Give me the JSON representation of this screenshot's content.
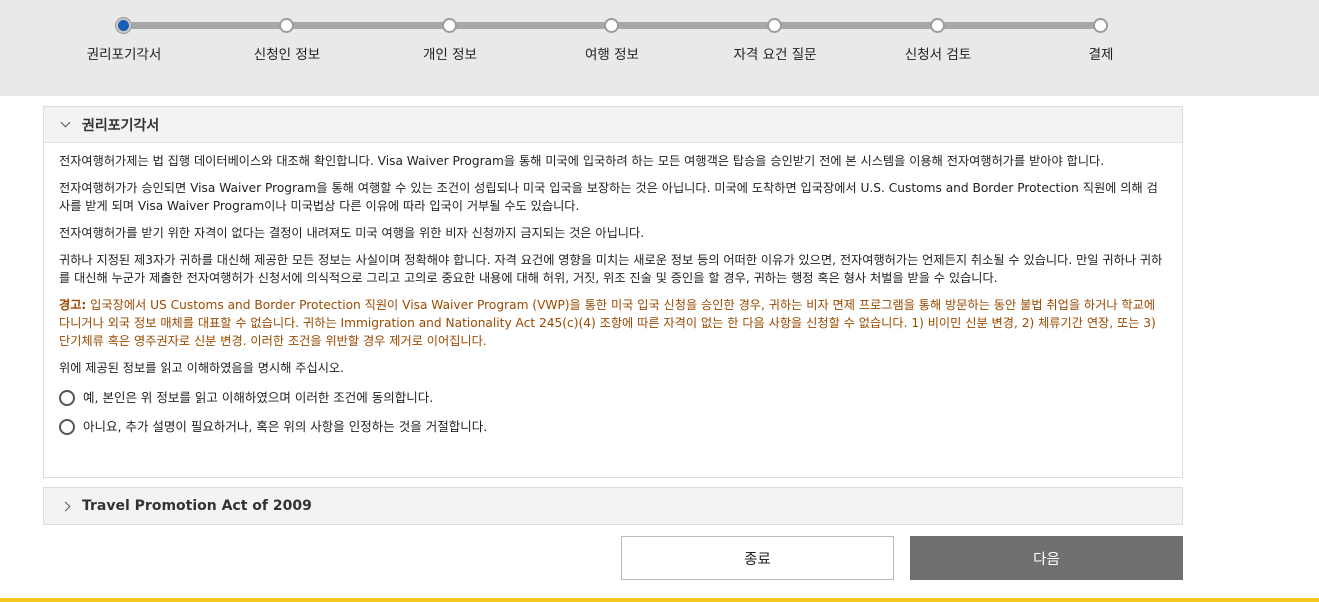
{
  "stepper": {
    "steps": [
      {
        "label": "권리포기각서",
        "active": true
      },
      {
        "label": "신청인 정보",
        "active": false
      },
      {
        "label": "개인 정보",
        "active": false
      },
      {
        "label": "여행 정보",
        "active": false
      },
      {
        "label": "자격 요건 질문",
        "active": false
      },
      {
        "label": "신청서 검토",
        "active": false
      },
      {
        "label": "결제",
        "active": false
      }
    ]
  },
  "waiver": {
    "title": "권리포기각서",
    "p1": "전자여행허가제는 법 집행 데이터베이스와 대조해 확인합니다. Visa Waiver Program을 통해 미국에 입국하려 하는 모든 여행객은 탑승을 승인받기 전에 본 시스템을 이용해 전자여행허가를 받아야 합니다.",
    "p2": "전자여행허가가 승인되면 Visa Waiver Program을 통해 여행할 수 있는 조건이 성립되나 미국 입국을 보장하는 것은 아닙니다. 미국에 도착하면 입국장에서 U.S. Customs and Border Protection 직원에 의해 검사를 받게 되며 Visa Waiver Program이나 미국법상 다른 이유에 따라 입국이 거부될 수도 있습니다.",
    "p3": "전자여행허가를 받기 위한 자격이 없다는 결정이 내려져도 미국 여행을 위한 비자 신청까지 금지되는 것은 아닙니다.",
    "p4": "귀하나 지정된 제3자가 귀하를 대신해 제공한 모든 정보는 사실이며 정확해야 합니다. 자격 요건에 영향을 미치는 새로운 정보 등의 어떠한 이유가 있으면, 전자여행허가는 언제든지 취소될 수 있습니다. 만일 귀하나 귀하를 대신해 누군가 제출한 전자여행허가 신청서에 의식적으로 그리고 고의로 중요한 내용에 대해 허위, 거짓, 위조 진술 및 증인을 할 경우, 귀하는 행정 혹은 형사 처벌을 받을 수 있습니다.",
    "warning_label": "경고:",
    "warning_text": " 입국장에서 US Customs and Border Protection 직원이 Visa Waiver Program (VWP)을 통한 미국 입국 신청을 승인한 경우, 귀하는 비자 면제 프로그램을 통해 방문하는 동안 불법 취업을 하거나 학교에 다니거나 외국 정보 매체를 대표할 수 없습니다. 귀하는 Immigration and Nationality Act 245(c)(4) 조항에 따른 자격이 없는 한 다음 사항을 신청할 수 없습니다. 1) 비이민 신분 변경, 2) 체류기간 연장, 또는 3) 단기체류 혹은 영주권자로 신분 변경. 이러한 조건을 위반할 경우 제거로 이어집니다.",
    "confirm_prompt": "위에 제공된 정보를 읽고 이해하였음을 명시해 주십시오.",
    "option_yes": "예, 본인은 위 정보를 읽고 이해하였으며 이러한 조건에 동의합니다.",
    "option_no": "아니요, 추가 설명이 필요하거나, 혹은 위의 사항을 인정하는 것을 거절합니다."
  },
  "travel_promotion": {
    "title": "Travel Promotion Act of 2009"
  },
  "buttons": {
    "close": "종료",
    "next": "다음"
  },
  "colors": {
    "active_step": "#1a5fb4",
    "warning": "#9a4a00",
    "next_button": "#707070",
    "footer_bar": "#f2c81e"
  }
}
